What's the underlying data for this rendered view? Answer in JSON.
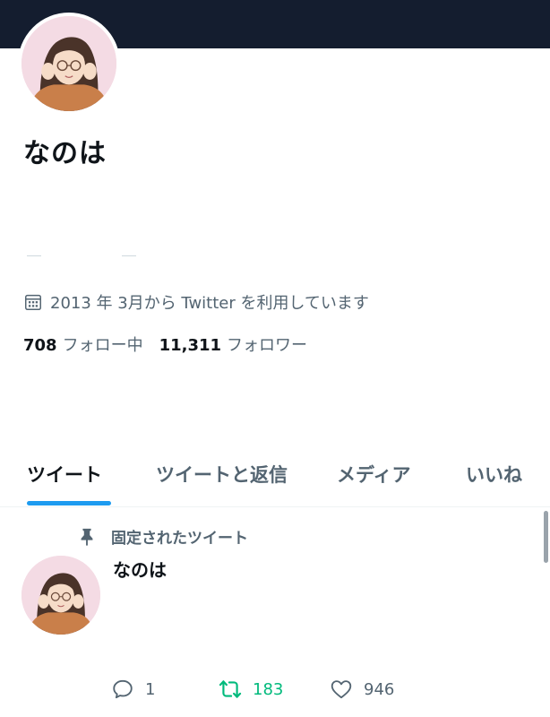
{
  "profile": {
    "display_name": "なのは",
    "joined": "2013 年 3月から Twitter を利用しています",
    "following_count": "708",
    "following_label": "フォロー中",
    "followers_count": "11,311",
    "followers_label": "フォロワー"
  },
  "tabs": [
    {
      "label": "ツイート",
      "active": true
    },
    {
      "label": "ツイートと返信",
      "active": false
    },
    {
      "label": "メディア",
      "active": false
    },
    {
      "label": "いいね",
      "active": false
    }
  ],
  "pinned_tweet": {
    "pinned_label": "固定されたツイート",
    "author": "なのは",
    "replies": "1",
    "retweets": "183",
    "likes": "946"
  },
  "colors": {
    "banner": "#141d2f",
    "accent": "#1d9bf0",
    "retweet": "#00ba7c",
    "secondary_text": "#536471"
  },
  "icons": [
    "calendar-icon",
    "pin-icon",
    "reply-icon",
    "retweet-icon",
    "like-icon"
  ]
}
